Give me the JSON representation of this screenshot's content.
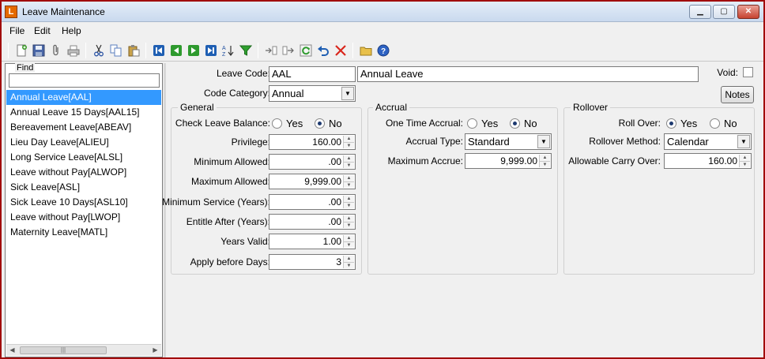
{
  "window": {
    "title": "Leave Maintenance",
    "icon": "app-icon",
    "icon_glyph": "L"
  },
  "controls": {
    "minimize": "▁",
    "maximize": "▢",
    "close": "✕"
  },
  "menu": [
    "File",
    "Edit",
    "Help"
  ],
  "toolbar_icons": [
    "new-icon",
    "save-icon",
    "attach-icon",
    "print-icon",
    "cut-icon",
    "copy-icon",
    "paste-icon",
    "first-record-icon",
    "previous-record-icon",
    "next-record-icon",
    "last-record-icon",
    "sort-icon",
    "filter-icon",
    "import-icon",
    "export-icon",
    "refresh-icon",
    "undo-icon",
    "delete-icon",
    "open-folder-icon",
    "help-icon"
  ],
  "find": {
    "label": "Find",
    "value": ""
  },
  "leave_list": [
    "Annual Leave[AAL]",
    "Annual Leave 15 Days[AAL15]",
    "Bereavement Leave[ABEAV]",
    "Lieu Day Leave[ALIEU]",
    "Long Service Leave[ALSL]",
    "Leave without Pay[ALWOP]",
    "Sick Leave[ASL]",
    "Sick Leave 10 Days[ASL10]",
    "Leave without Pay[LWOP]",
    "Maternity Leave[MATL]"
  ],
  "selected_index": 0,
  "form": {
    "leave_code_label": "Leave Code:",
    "leave_code": "AAL",
    "leave_name": "Annual Leave",
    "void_label": "Void:",
    "void_checked": false,
    "code_category_label": "Code Category:",
    "code_category": "Annual",
    "notes_label": "Notes"
  },
  "general": {
    "title": "General",
    "check_balance_label": "Check Leave Balance:",
    "yes": "Yes",
    "no": "No",
    "check_balance": "No",
    "privilege_label": "Privilege:",
    "privilege": "160.00",
    "min_allowed_label": "Minimum Allowed:",
    "min_allowed": ".00",
    "max_allowed_label": "Maximum Allowed:",
    "max_allowed": "9,999.00",
    "min_service_label": "Minimum Service (Years):",
    "min_service": ".00",
    "entitle_after_label": "Entitle After (Years):",
    "entitle_after": ".00",
    "years_valid_label": "Years Valid:",
    "years_valid": "1.00",
    "apply_before_label": "Apply before Days:",
    "apply_before": "3"
  },
  "accrual": {
    "title": "Accrual",
    "one_time_label": "One Time Accrual:",
    "yes": "Yes",
    "no": "No",
    "one_time": "No",
    "type_label": "Accrual Type:",
    "type": "Standard",
    "max_label": "Maximum Accrue:",
    "max": "9,999.00"
  },
  "rollover": {
    "title": "Rollover",
    "roll_over_label": "Roll Over:",
    "yes": "Yes",
    "no": "No",
    "roll_over": "Yes",
    "method_label": "Rollover Method:",
    "method": "Calendar",
    "carry_label": "Allowable Carry Over:",
    "carry": "160.00"
  },
  "colors": {
    "selection": "#3399ff",
    "window_border": "#a10c0c"
  }
}
